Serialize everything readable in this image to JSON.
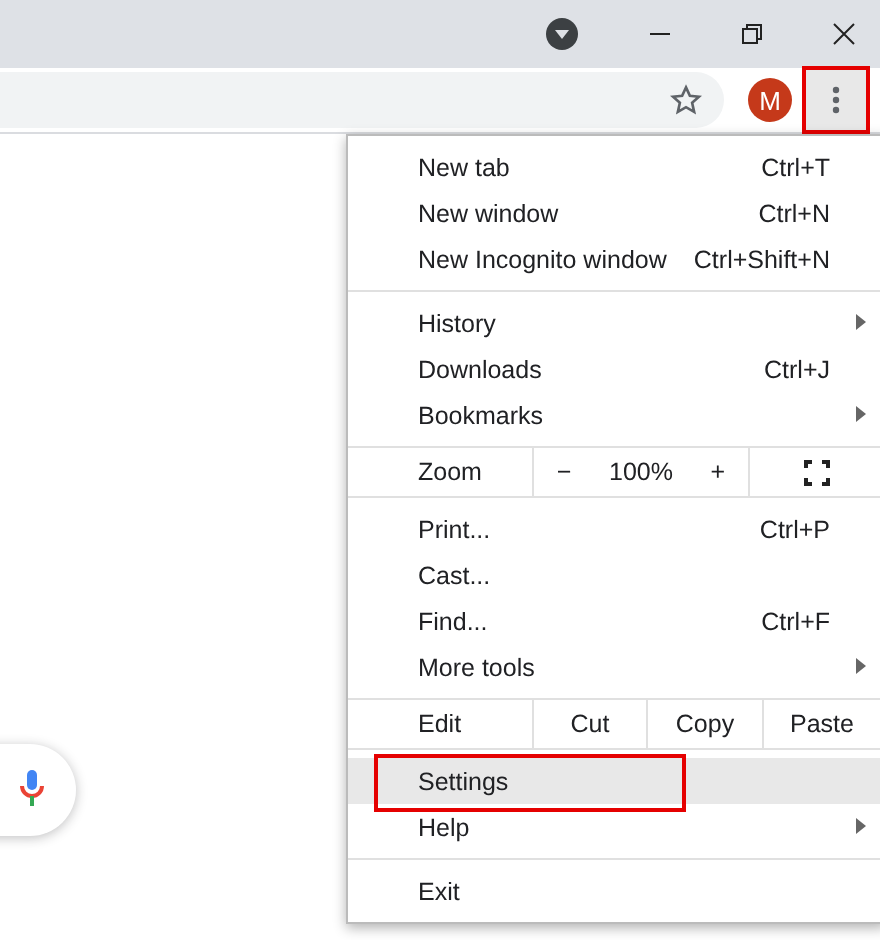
{
  "toolbar": {
    "avatar_letter": "M",
    "menu_button": {
      "outlined": true
    }
  },
  "menu": {
    "sections": [
      {
        "items": [
          {
            "kind": "item",
            "label": "New tab",
            "shortcut": "Ctrl+T",
            "submenu": false,
            "selected": false,
            "outlined": false
          },
          {
            "kind": "item",
            "label": "New window",
            "shortcut": "Ctrl+N",
            "submenu": false,
            "selected": false,
            "outlined": false
          },
          {
            "kind": "item",
            "label": "New Incognito window",
            "shortcut": "Ctrl+Shift+N",
            "submenu": false,
            "selected": false,
            "outlined": false
          }
        ]
      },
      {
        "items": [
          {
            "kind": "item",
            "label": "History",
            "submenu": true,
            "selected": false,
            "outlined": false
          },
          {
            "kind": "item",
            "label": "Downloads",
            "shortcut": "Ctrl+J",
            "submenu": false,
            "selected": false,
            "outlined": false
          },
          {
            "kind": "item",
            "label": "Bookmarks",
            "submenu": true,
            "selected": false,
            "outlined": false
          }
        ]
      },
      {
        "items": [
          {
            "kind": "zoom",
            "label": "Zoom",
            "minus": "−",
            "value": "100%",
            "plus": "+"
          }
        ]
      },
      {
        "items": [
          {
            "kind": "item",
            "label": "Print...",
            "shortcut": "Ctrl+P",
            "submenu": false,
            "selected": false,
            "outlined": false
          },
          {
            "kind": "item",
            "label": "Cast...",
            "submenu": false,
            "selected": false,
            "outlined": false
          },
          {
            "kind": "item",
            "label": "Find...",
            "shortcut": "Ctrl+F",
            "submenu": false,
            "selected": false,
            "outlined": false
          },
          {
            "kind": "item",
            "label": "More tools",
            "submenu": true,
            "selected": false,
            "outlined": false
          }
        ]
      },
      {
        "items": [
          {
            "kind": "edit",
            "label": "Edit",
            "buttons": [
              "Cut",
              "Copy",
              "Paste"
            ]
          }
        ]
      },
      {
        "items": [
          {
            "kind": "item",
            "label": "Settings",
            "submenu": false,
            "selected": true,
            "outlined": true
          },
          {
            "kind": "item",
            "label": "Help",
            "submenu": true,
            "selected": false,
            "outlined": false
          }
        ]
      },
      {
        "items": [
          {
            "kind": "item",
            "label": "Exit",
            "submenu": false,
            "selected": false,
            "outlined": false
          }
        ]
      }
    ]
  }
}
